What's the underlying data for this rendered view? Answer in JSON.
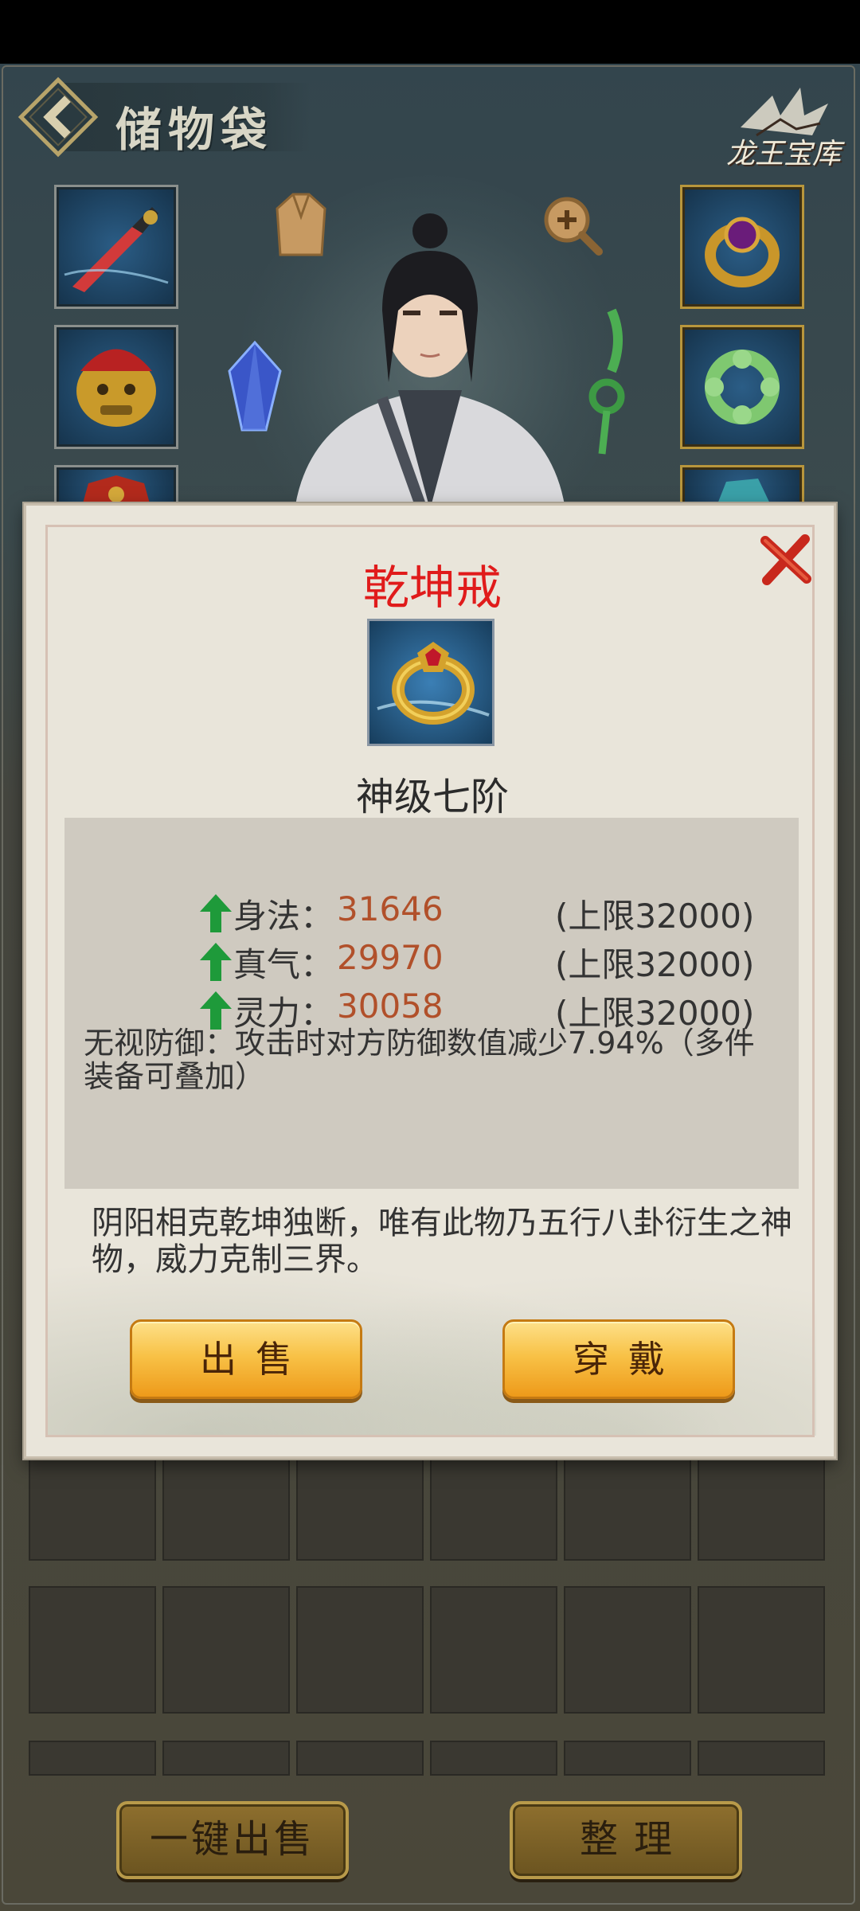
{
  "header": {
    "title": "储物袋",
    "brand": "龙王宝库"
  },
  "equipment": {
    "left_slots": [
      "sword-icon",
      "beast-helmet-icon",
      "armor-icon"
    ],
    "right_slots": [
      "ring-icon",
      "jade-bracelet-icon",
      "boots-icon"
    ],
    "floating": [
      "robe-icon",
      "zoom-in-icon",
      "crystal-icon",
      "jade-pendant-icon"
    ]
  },
  "item_popup": {
    "name": "乾坤戒",
    "grade": "神级七阶",
    "stats": [
      {
        "label": "身法：",
        "value": "31646",
        "limit": "(上限32000)",
        "trend": "up"
      },
      {
        "label": "真气：",
        "value": "29970",
        "limit": "(上限32000)",
        "trend": "up"
      },
      {
        "label": "灵力：",
        "value": "30058",
        "limit": "(上限32000)",
        "trend": "up"
      }
    ],
    "special": "无视防御：攻击时对方防御数值减少7.94%（多件装备可叠加）",
    "description": "阴阳相克乾坤独断，唯有此物乃五行八卦衍生之神物，威力克制三界。",
    "sell_label": "出售",
    "equip_label": "穿戴"
  },
  "bottom_bar": {
    "quick_sell_label": "一键出售",
    "sort_label": "整理"
  },
  "colors": {
    "item_name": "#e01b1b",
    "stat_value": "#b1502a",
    "arrow": "#1e9a3a",
    "button_gold": "#f8c247"
  }
}
